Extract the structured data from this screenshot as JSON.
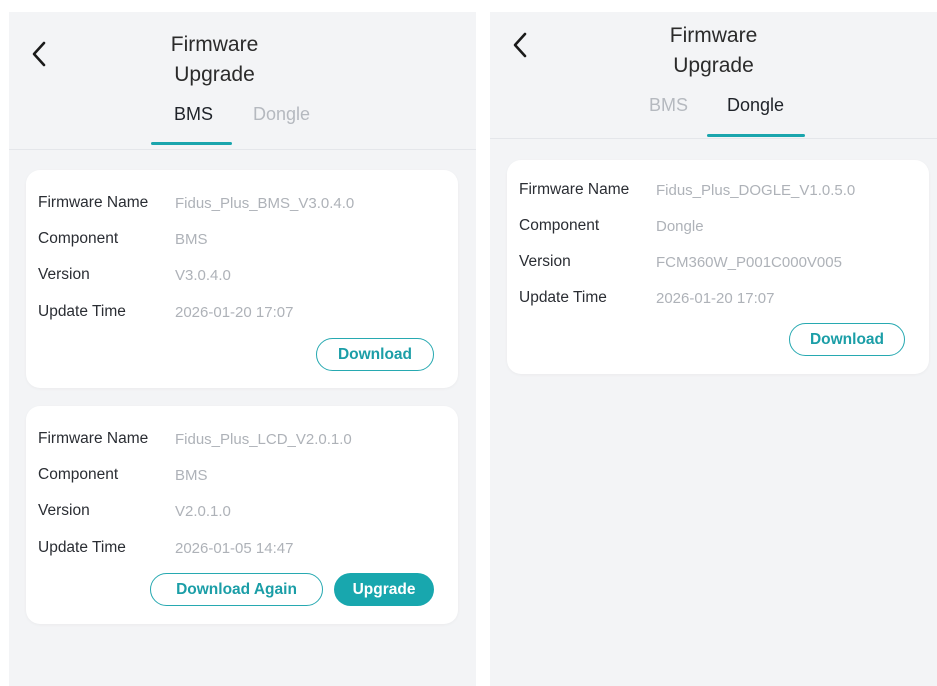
{
  "screens": [
    {
      "title_line1": "Firmware",
      "title_line2": "Upgrade",
      "tabs": [
        {
          "label": "BMS",
          "active": true
        },
        {
          "label": "Dongle",
          "active": false
        }
      ],
      "cards": [
        {
          "fields": [
            {
              "key": "Firmware Name",
              "value": "Fidus_Plus_BMS_V3.0.4.0"
            },
            {
              "key": "Component",
              "value": "BMS"
            },
            {
              "key": "Version",
              "value": "V3.0.4.0"
            },
            {
              "key": "Update Time",
              "value": "2026-01-20 17:07"
            }
          ],
          "buttons": [
            {
              "label": "Download",
              "style": "outline"
            }
          ]
        },
        {
          "fields": [
            {
              "key": "Firmware Name",
              "value": "Fidus_Plus_LCD_V2.0.1.0"
            },
            {
              "key": "Component",
              "value": "BMS"
            },
            {
              "key": "Version",
              "value": "V2.0.1.0"
            },
            {
              "key": "Update Time",
              "value": "2026-01-05 14:47"
            }
          ],
          "buttons": [
            {
              "label": "Download Again",
              "style": "outline"
            },
            {
              "label": "Upgrade",
              "style": "filled"
            }
          ]
        }
      ]
    },
    {
      "title_line1": "Firmware",
      "title_line2": "Upgrade",
      "tabs": [
        {
          "label": "BMS",
          "active": false
        },
        {
          "label": "Dongle",
          "active": true
        }
      ],
      "cards": [
        {
          "fields": [
            {
              "key": "Firmware Name",
              "value": "Fidus_Plus_DOGLE_V1.0.5.0"
            },
            {
              "key": "Component",
              "value": "Dongle"
            },
            {
              "key": "Version",
              "value": "FCM360W_P001C000V005"
            },
            {
              "key": "Update Time",
              "value": "2026-01-20 17:07"
            }
          ],
          "buttons": [
            {
              "label": "Download",
              "style": "outline"
            }
          ]
        }
      ]
    }
  ],
  "colors": {
    "accent": "#18a7ae",
    "label": "#2a2d33",
    "value": "#aeb2b8",
    "background": "#f3f4f6"
  },
  "icons": {
    "back": "chevron-left-icon"
  }
}
